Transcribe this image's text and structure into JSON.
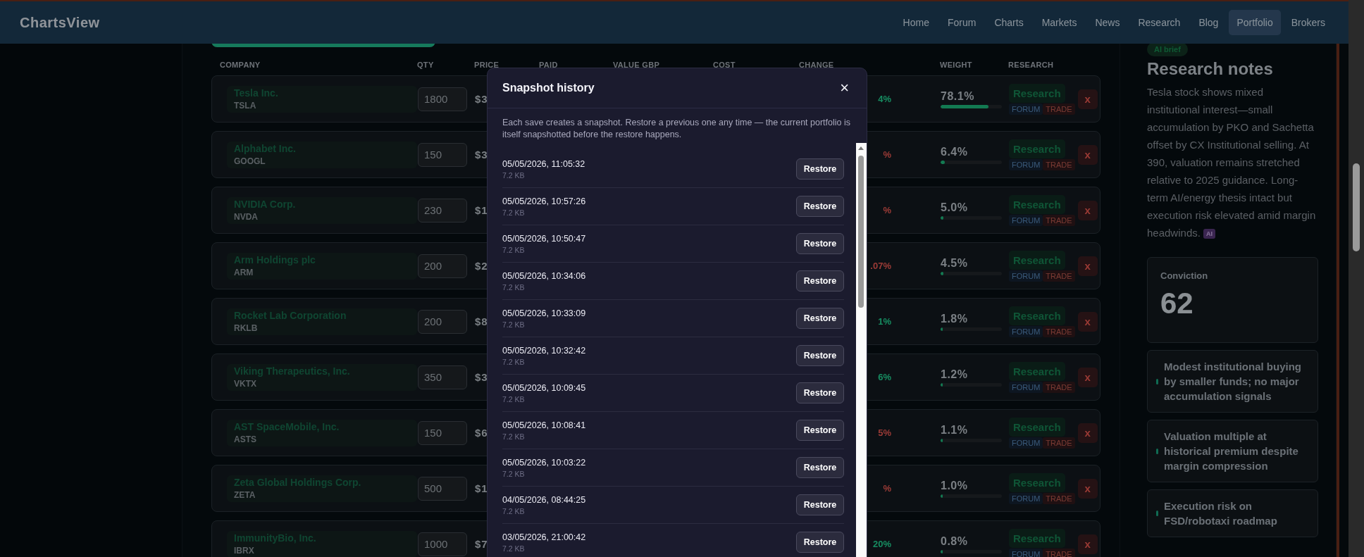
{
  "brand": "ChartsView",
  "nav": [
    {
      "label": "Home",
      "selected": false
    },
    {
      "label": "Forum",
      "selected": false
    },
    {
      "label": "Charts",
      "selected": false
    },
    {
      "label": "Markets",
      "selected": false
    },
    {
      "label": "News",
      "selected": false
    },
    {
      "label": "Research",
      "selected": false
    },
    {
      "label": "Blog",
      "selected": false
    },
    {
      "label": "Portfolio",
      "selected": true
    },
    {
      "label": "Brokers",
      "selected": false
    }
  ],
  "table": {
    "columns": [
      "COMPANY",
      "QTY",
      "PRICE",
      "PAID",
      "VALUE GBP",
      "COST",
      "CHANGE",
      "WEIGHT",
      "RESEARCH"
    ],
    "rows": [
      {
        "company": "Tesla Inc.",
        "ticker": "TSLA",
        "qty": "1800",
        "price": "$3",
        "change": "4%",
        "positive": true,
        "weight": "78.1%",
        "level": 0.781,
        "research": "Research",
        "forum": "FORUM",
        "trade": "TRADE",
        "remove": "x"
      },
      {
        "company": "Alphabet Inc.",
        "ticker": "GOOGL",
        "qty": "150",
        "price": "$3",
        "change": "%",
        "positive": false,
        "weight": "6.4%",
        "level": 0.064,
        "research": "Research",
        "forum": "FORUM",
        "trade": "TRADE",
        "remove": "x"
      },
      {
        "company": "NVIDIA Corp.",
        "ticker": "NVDA",
        "qty": "230",
        "price": "$1",
        "change": "%",
        "positive": false,
        "weight": "5.0%",
        "level": 0.05,
        "research": "Research",
        "forum": "FORUM",
        "trade": "TRADE",
        "remove": "x"
      },
      {
        "company": "Arm Holdings plc",
        "ticker": "ARM",
        "qty": "200",
        "price": "$2",
        "change": ".07%",
        "positive": false,
        "weight": "4.5%",
        "level": 0.045,
        "research": "Research",
        "forum": "FORUM",
        "trade": "TRADE",
        "remove": "x"
      },
      {
        "company": "Rocket Lab Corporation",
        "ticker": "RKLB",
        "qty": "200",
        "price": "$8",
        "change": "1%",
        "positive": true,
        "weight": "1.8%",
        "level": 0.018,
        "research": "Research",
        "forum": "FORUM",
        "trade": "TRADE",
        "remove": "x"
      },
      {
        "company": "Viking Therapeutics, Inc.",
        "ticker": "VKTX",
        "qty": "350",
        "price": "$3",
        "change": "6%",
        "positive": true,
        "weight": "1.2%",
        "level": 0.012,
        "research": "Research",
        "forum": "FORUM",
        "trade": "TRADE",
        "remove": "x"
      },
      {
        "company": "AST SpaceMobile, Inc.",
        "ticker": "ASTS",
        "qty": "150",
        "price": "$6",
        "change": "5%",
        "positive": false,
        "weight": "1.1%",
        "level": 0.011,
        "research": "Research",
        "forum": "FORUM",
        "trade": "TRADE",
        "remove": "x"
      },
      {
        "company": "Zeta Global Holdings Corp.",
        "ticker": "ZETA",
        "qty": "500",
        "price": "$1",
        "change": "%",
        "positive": false,
        "weight": "1.0%",
        "level": 0.01,
        "research": "Research",
        "forum": "FORUM",
        "trade": "TRADE",
        "remove": "x"
      },
      {
        "company": "ImmunityBio, Inc.",
        "ticker": "IBRX",
        "qty": "1000",
        "price": "$7",
        "change": "20%",
        "positive": true,
        "weight": "0.8%",
        "level": 0.008,
        "research": "Research",
        "forum": "FORUM",
        "trade": "TRADE",
        "remove": "x"
      }
    ]
  },
  "notes": {
    "tag": "AI brief",
    "title": "Research notes",
    "text": "Tesla stock shows mixed institutional interest—small accumulation by PKO and Sachetta offset by CX Institutional selling. At 390, valuation remains stretched relative to 2025 guidance. Long-term AI/energy thesis intact but execution risk elevated amid margin headwinds.",
    "badge": "AI",
    "conviction": {
      "label": "Conviction",
      "value": "62"
    },
    "points": [
      "Modest institutional buying by smaller funds; no major accumulation signals",
      "Valuation multiple at historical premium despite margin compression",
      "Execution risk on FSD/robotaxi roadmap"
    ]
  },
  "modal": {
    "title": "Snapshot history",
    "close": "×",
    "description": "Each save creates a snapshot. Restore a previous one any time — the current portfolio is itself snapshotted before the restore happens.",
    "snapshots": [
      {
        "time": "05/05/2026, 11:05:32",
        "size": "7.2 KB",
        "action": "Restore"
      },
      {
        "time": "05/05/2026, 10:57:26",
        "size": "7.2 KB",
        "action": "Restore"
      },
      {
        "time": "05/05/2026, 10:50:47",
        "size": "7.2 KB",
        "action": "Restore"
      },
      {
        "time": "05/05/2026, 10:34:06",
        "size": "7.2 KB",
        "action": "Restore"
      },
      {
        "time": "05/05/2026, 10:33:09",
        "size": "7.2 KB",
        "action": "Restore"
      },
      {
        "time": "05/05/2026, 10:32:42",
        "size": "7.2 KB",
        "action": "Restore"
      },
      {
        "time": "05/05/2026, 10:09:45",
        "size": "7.2 KB",
        "action": "Restore"
      },
      {
        "time": "05/05/2026, 10:08:41",
        "size": "7.2 KB",
        "action": "Restore"
      },
      {
        "time": "05/05/2026, 10:03:22",
        "size": "7.2 KB",
        "action": "Restore"
      },
      {
        "time": "04/05/2026, 08:44:25",
        "size": "7.2 KB",
        "action": "Restore"
      },
      {
        "time": "03/05/2026, 21:00:42",
        "size": "7.2 KB",
        "action": "Restore"
      }
    ]
  }
}
